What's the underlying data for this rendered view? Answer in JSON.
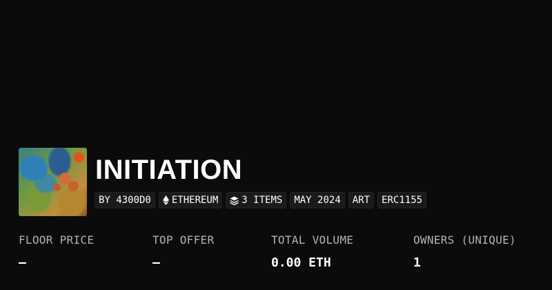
{
  "collection": {
    "title": "INITIATION",
    "tags": {
      "creator": "BY 4300D0",
      "chain": "ETHEREUM",
      "items": "3 ITEMS",
      "date": "MAY 2024",
      "category": "ART",
      "standard": "ERC1155"
    },
    "icons": {
      "chain": "ethereum-icon",
      "items": "layers-icon"
    }
  },
  "stats": {
    "floor_price": {
      "label": "FLOOR PRICE",
      "value": "—"
    },
    "top_offer": {
      "label": "TOP OFFER",
      "value": "—"
    },
    "total_volume": {
      "label": "TOTAL VOLUME",
      "value": "0.00 ETH"
    },
    "owners": {
      "label": "OWNERS (UNIQUE)",
      "value": "1"
    }
  },
  "colors": {
    "background": "#0b0b0b",
    "tag_background": "#1a1a1a",
    "label": "#b3b3b3",
    "text": "#ffffff"
  }
}
